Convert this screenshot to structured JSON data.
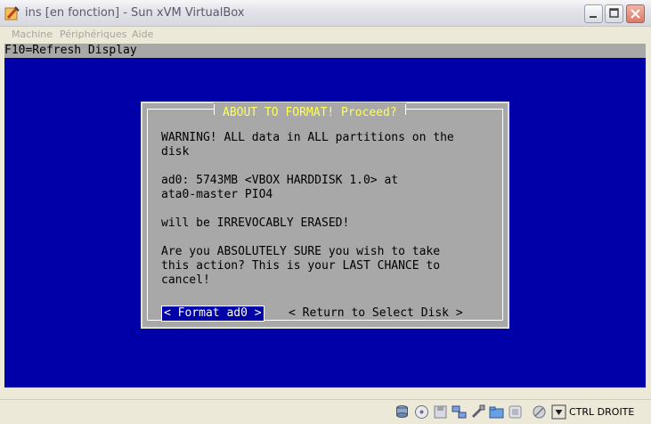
{
  "window": {
    "title": "ins [en fonction] - Sun xVM VirtualBox"
  },
  "menu": {
    "items": [
      "Machine",
      "Périphériques",
      "Aide"
    ]
  },
  "vm": {
    "top_line": "F10=Refresh Display",
    "dialog": {
      "title": "ABOUT TO FORMAT! Proceed?",
      "warning": "WARNING! ALL data in ALL partitions on the\ndisk",
      "disk_info": "ad0: 5743MB <VBOX HARDDISK 1.0> at\nata0-master PIO4",
      "erase": "will be IRREVOCABLY ERASED!",
      "confirm": "Are you ABSOLUTELY SURE you wish to take\nthis action? This is your LAST CHANCE to\ncancel!",
      "format_button": "< Format ad0 >",
      "return_button": "< Return to Select Disk >"
    }
  },
  "statusbar": {
    "host_key": "CTRL DROITE",
    "icons": [
      "hard-disk-icon",
      "cd-dvd-icon",
      "floppy-icon",
      "network-icon",
      "usb-icon",
      "shared-folder-icon",
      "vrdp-icon",
      "mouse-integration-icon",
      "host-key-icon"
    ]
  },
  "colors": {
    "vm_background": "#0000a8",
    "dialog_background": "#a8a8a8",
    "dialog_title": "#ffff55",
    "selected_button": "#0000a8"
  }
}
